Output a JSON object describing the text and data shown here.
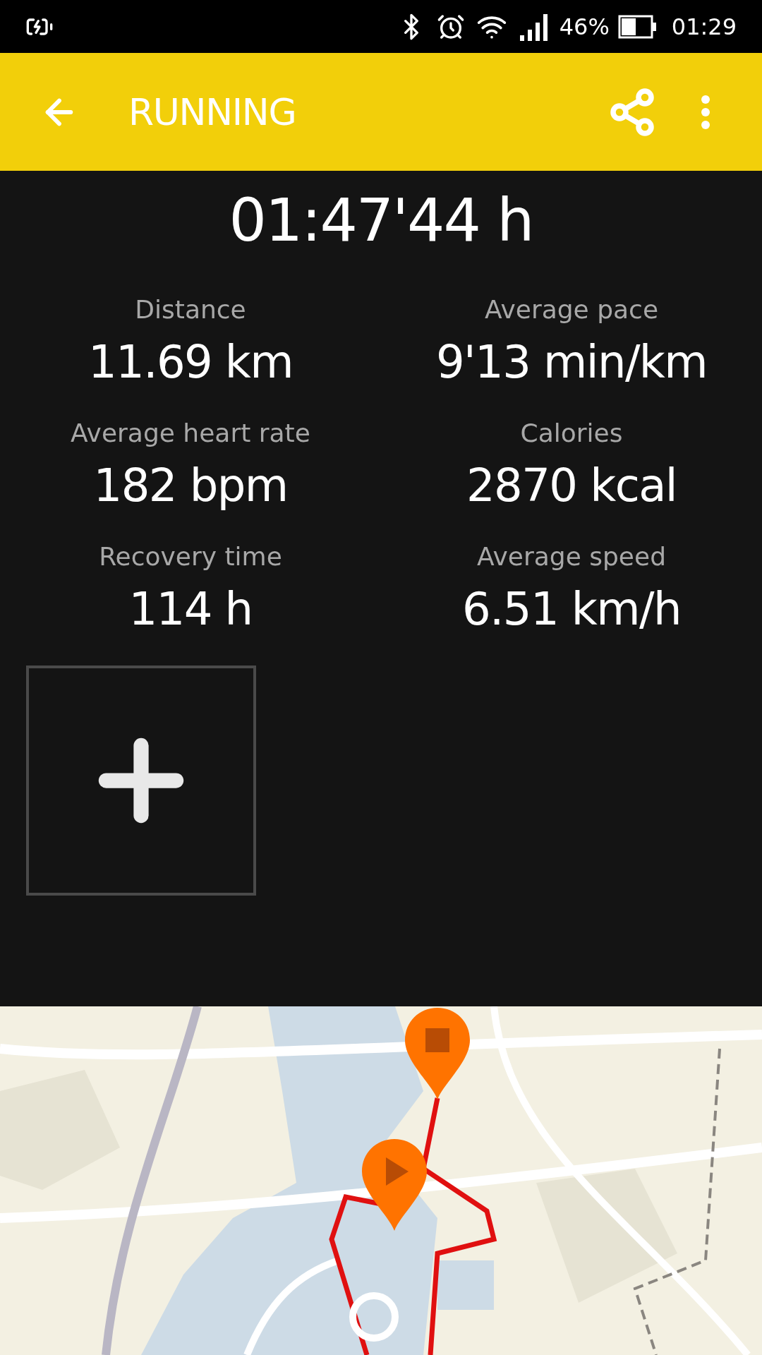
{
  "status_bar": {
    "battery_percent": "46%",
    "time": "01:29"
  },
  "app_bar": {
    "title": "RUNNING"
  },
  "duration": "01:47'44 h",
  "stats": [
    {
      "label": "Distance",
      "value": "11.69 km"
    },
    {
      "label": "Average pace",
      "value": "9'13 min/km"
    },
    {
      "label": "Average heart rate",
      "value": "182 bpm"
    },
    {
      "label": "Calories",
      "value": "2870 kcal"
    },
    {
      "label": "Recovery time",
      "value": "114 h"
    },
    {
      "label": "Average speed",
      "value": "6.51 km/h"
    }
  ]
}
